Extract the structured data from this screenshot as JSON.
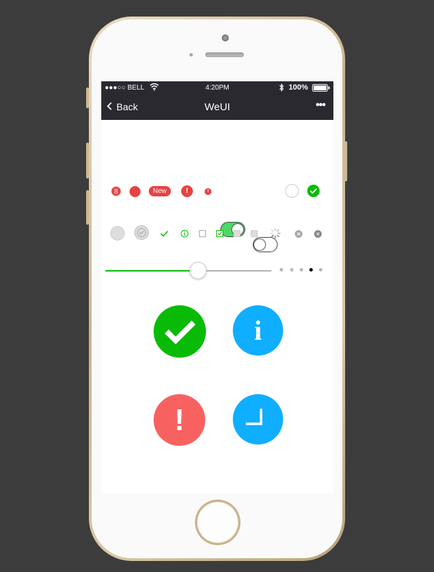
{
  "status_bar": {
    "carrier": "●●●○○ BELL",
    "time": "4:20PM",
    "battery": "100%"
  },
  "nav_bar": {
    "back_label": "Back",
    "title": "WeUI",
    "more_label": "•••"
  },
  "badges": {
    "number": "8",
    "new_label": "New"
  },
  "slider": {
    "value": 0.5
  },
  "page_dots": {
    "count": 5,
    "active_index": 3
  },
  "big_icons": {
    "info_glyph": "i",
    "warn_glyph": "!"
  },
  "colors": {
    "nav_bg": "#2b2930",
    "accent_green": "#09bb07",
    "badge_red": "#e64340",
    "info_blue": "#10aeff",
    "warn_red": "#f76260"
  }
}
